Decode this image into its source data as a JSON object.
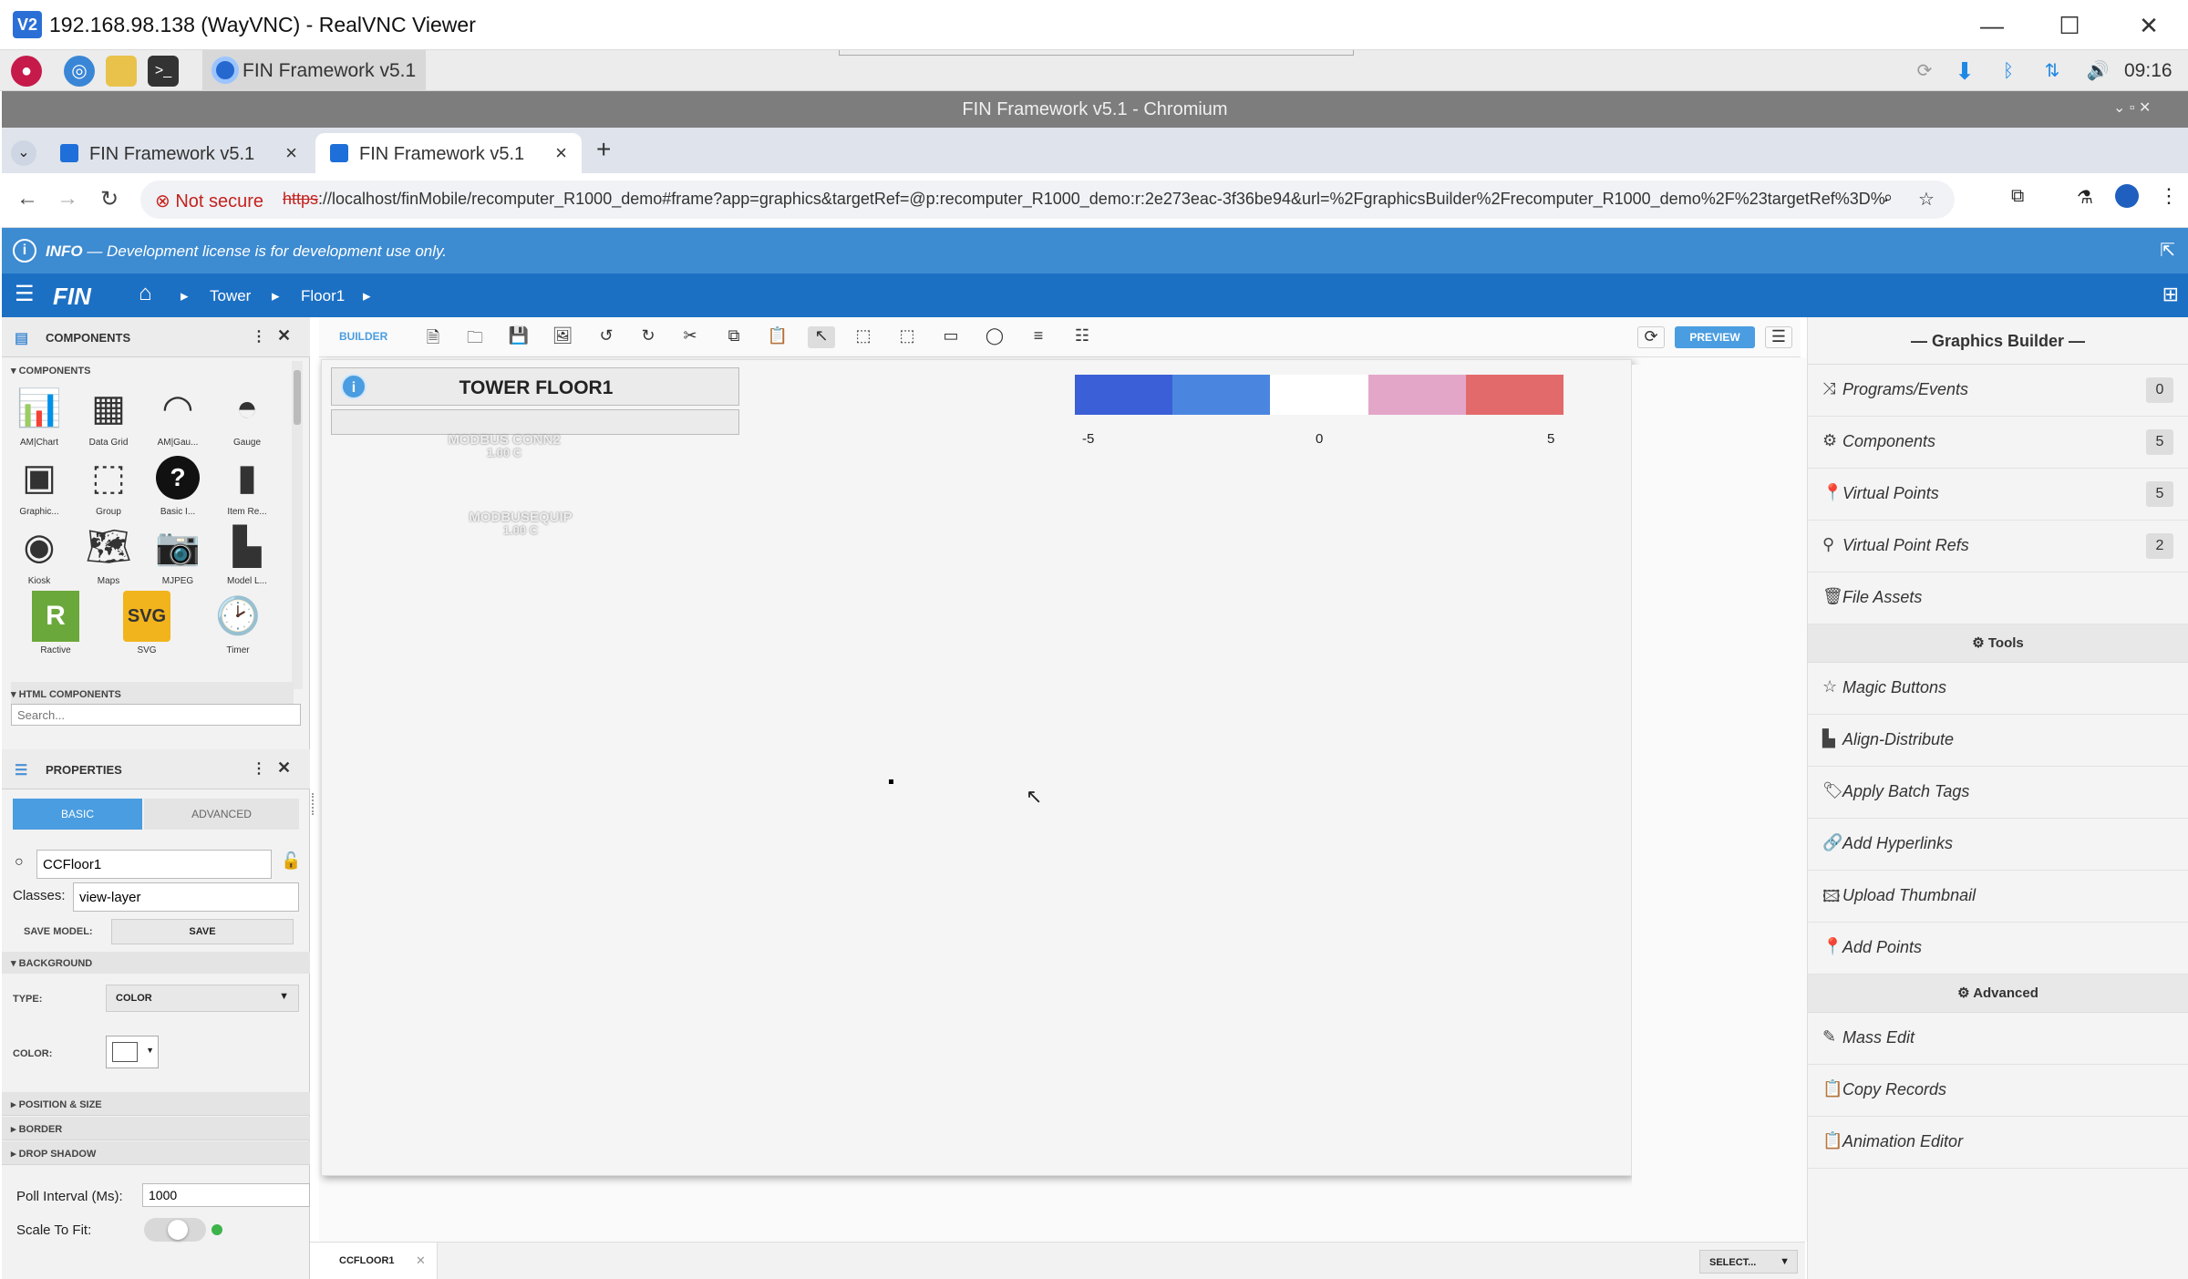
{
  "vnc": {
    "title": "192.168.98.138 (WayVNC) - RealVNC Viewer",
    "app_icon": "V2",
    "minimize": "—",
    "maximize": "☐",
    "close": "✕"
  },
  "taskbar": {
    "task_label": "FIN Framework v5.1 ..",
    "clock": "09:16"
  },
  "chrome": {
    "window_title": "FIN Framework v5.1 - Chromium",
    "tabs": [
      {
        "label": "FIN Framework v5.1"
      },
      {
        "label": "FIN Framework v5.1"
      }
    ],
    "not_secure": "Not secure",
    "url_scheme": "https",
    "url_rest": "://localhost/finMobile/recomputer_R1000_demo#frame?app=graphics&targetRef=@p:recomputer_R1000_demo:r:2e273eac-3f36be94&url=%2FgraphicsBuilder%2Frecomputer_R1000_demo%2F%23targetRef%3D%40p%3Are..."
  },
  "info": {
    "label": "INFO",
    "text": " — Development license is for development use only."
  },
  "finnav": {
    "logo": "FIN",
    "crumbs": [
      "Tower",
      "Floor1"
    ]
  },
  "components_panel": {
    "title": "COMPONENTS",
    "section": "COMPONENTS",
    "items": [
      {
        "label": "AM|Chart",
        "icon": "chart-icon"
      },
      {
        "label": "Data Grid",
        "icon": "grid-icon"
      },
      {
        "label": "AM|Gau...",
        "icon": "gauge-outline-icon"
      },
      {
        "label": "Gauge",
        "icon": "gauge-icon"
      },
      {
        "label": "Graphic...",
        "icon": "graphic-icon"
      },
      {
        "label": "Group",
        "icon": "group-icon"
      },
      {
        "label": "Basic I...",
        "icon": "question-icon"
      },
      {
        "label": "Item Re...",
        "icon": "item-repeater-icon"
      },
      {
        "label": "Kiosk",
        "icon": "kiosk-icon"
      },
      {
        "label": "Maps",
        "icon": "maps-icon"
      },
      {
        "label": "MJPEG",
        "icon": "camera-icon"
      },
      {
        "label": "Model L...",
        "icon": "model-icon"
      },
      {
        "label": "Ractive",
        "icon": "ractive-icon"
      },
      {
        "label": "SVG",
        "icon": "svg-icon"
      },
      {
        "label": "Timer",
        "icon": "clock-icon"
      }
    ],
    "html_section": "HTML COMPONENTS",
    "search_placeholder": "Search..."
  },
  "properties": {
    "title": "PROPERTIES",
    "tab_basic": "BASIC",
    "tab_advanced": "ADVANCED",
    "name_value": "CCFloor1",
    "classes_label": "Classes:",
    "classes_value": "view-layer",
    "save_model_label": "SAVE MODEL:",
    "save_button": "SAVE",
    "background_label": "BACKGROUND",
    "type_label": "TYPE:",
    "type_value": "COLOR",
    "color_label": "COLOR:",
    "position_label": "POSITION & SIZE",
    "border_label": "BORDER",
    "shadow_label": "DROP SHADOW",
    "poll_label": "Poll Interval (Ms):",
    "poll_value": "1000",
    "scale_label": "Scale To Fit:"
  },
  "builder": {
    "label": "BUILDER",
    "preview": "PREVIEW",
    "header_title": "TOWER FLOOR1",
    "labels": [
      {
        "name": "MODBUS CONN2",
        "value": "1.00 C"
      },
      {
        "name": "MODBUSEQUIP",
        "value": "1.00 C"
      }
    ],
    "colorbar_colors": [
      "#3b5fd6",
      "#4a86e0",
      "#ffffff",
      "#e3a6c8",
      "#e36a6a"
    ],
    "colorbar_ticks": [
      "-5",
      "0",
      "5"
    ],
    "bottom_tab": "CCFLOOR1",
    "select_button": "SELECT..."
  },
  "graphics_builder": {
    "title": "— Graphics Builder —",
    "items": [
      {
        "label": "Programs/Events",
        "icon": "programs-icon",
        "badge": "0"
      },
      {
        "label": "Components",
        "icon": "gear-icon",
        "badge": "5"
      },
      {
        "label": "Virtual Points",
        "icon": "pin-icon",
        "badge": "5"
      },
      {
        "label": "Virtual Point Refs",
        "icon": "pin-outline-icon",
        "badge": "2"
      },
      {
        "label": "File Assets",
        "icon": "basket-icon",
        "badge": ""
      }
    ],
    "tools_title": "Tools",
    "tools": [
      {
        "label": "Magic Buttons",
        "icon": "star-icon"
      },
      {
        "label": "Align-Distribute",
        "icon": "align-icon"
      },
      {
        "label": "Apply Batch Tags",
        "icon": "tag-icon"
      },
      {
        "label": "Add Hyperlinks",
        "icon": "link-icon"
      },
      {
        "label": "Upload Thumbnail",
        "icon": "image-icon"
      },
      {
        "label": "Add Points",
        "icon": "pin-icon"
      }
    ],
    "advanced_title": "Advanced",
    "advanced": [
      {
        "label": "Mass Edit",
        "icon": "edit-icon"
      },
      {
        "label": "Copy Records",
        "icon": "clipboard-icon"
      },
      {
        "label": "Animation Editor",
        "icon": "clipboard-icon"
      }
    ]
  }
}
